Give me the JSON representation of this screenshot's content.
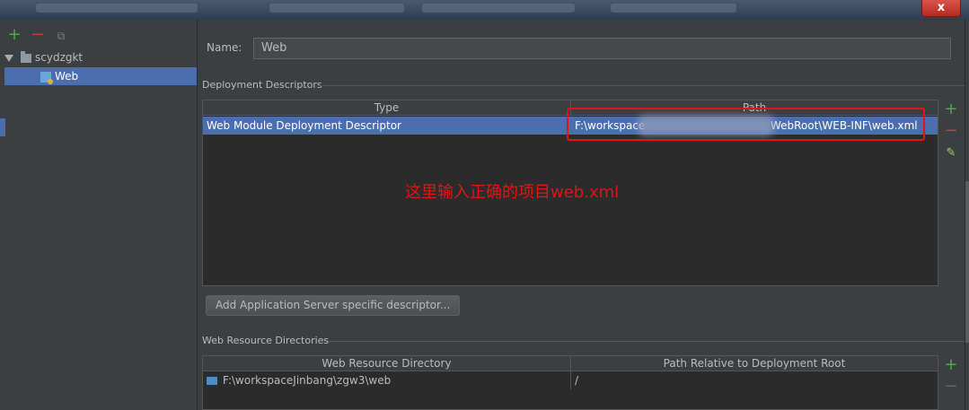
{
  "window": {
    "close_label": "x"
  },
  "left_panel": {
    "toolbar": {
      "add": "+",
      "remove": "−",
      "copy": "⧉"
    },
    "tree": [
      {
        "label": "scydzgkt",
        "expanded": true,
        "icon": "folder-icon"
      },
      {
        "label": "Web",
        "selected": true,
        "icon": "web-facet-icon"
      }
    ]
  },
  "name_field": {
    "label": "Name:",
    "value": "Web"
  },
  "deployment_descriptors": {
    "title": "Deployment Descriptors",
    "columns": [
      "Type",
      "Path"
    ],
    "rows": [
      {
        "type": "Web Module Deployment Descriptor",
        "path_prefix": "F:\\workspace",
        "path_suffix": "WebRoot\\WEB-INF\\web.xml",
        "selected": true
      }
    ],
    "annotation": "这里输入正确的项目web.xml",
    "add_button": "Add Application Server specific descriptor..."
  },
  "web_resource_directories": {
    "title": "Web Resource Directories",
    "columns": [
      "Web Resource Directory",
      "Path Relative to Deployment Root"
    ],
    "rows": [
      {
        "directory": "F:\\workspaceJinbang\\zgw3\\web",
        "relative_path": "/"
      }
    ]
  },
  "side_tools": {
    "add": "+",
    "remove": "−",
    "edit": "✎"
  },
  "colors": {
    "background": "#3c3f41",
    "selection": "#4b6eaf",
    "annotation": "#e01515",
    "add_green": "#4fa84a",
    "remove_red": "#c74036"
  }
}
